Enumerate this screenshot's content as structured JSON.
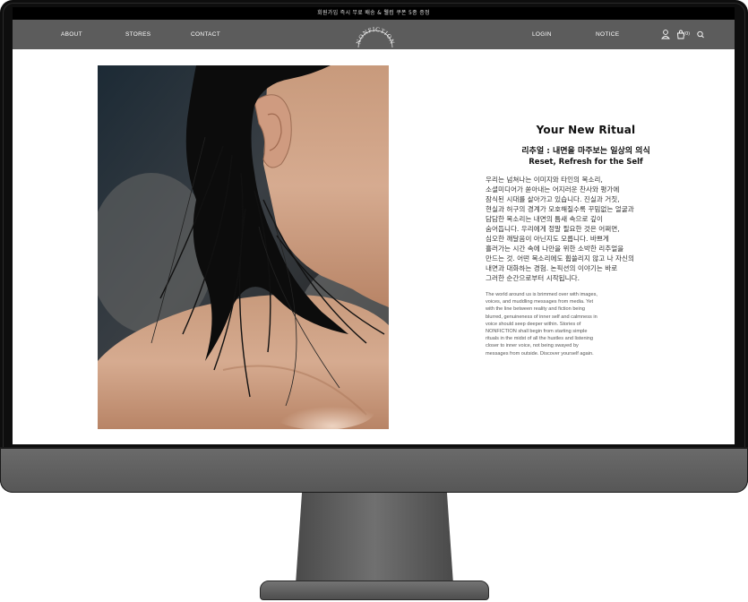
{
  "announcement": "회원가입 즉시 무료 배송 & 웰컴 쿠폰 5종 증정",
  "nav": {
    "left": [
      "ABOUT",
      "STORES",
      "CONTACT"
    ],
    "logo": "NONFICTION",
    "right": [
      "LOGIN",
      "NOTICE"
    ],
    "cart_count": "(0)",
    "icons": [
      "user-icon",
      "cart-icon",
      "search-icon"
    ]
  },
  "content": {
    "title": "Your New Ritual",
    "subtitle_ko": "리추얼 : 내면을 마주보는 일상의 의식",
    "subtitle_en": "Reset, Refresh for the Self",
    "body_ko": [
      "우리는 넘쳐나는 이미지와 타인의 목소리,",
      "소셜미디어가 쏟아내는 어지러운 찬사와 평가에",
      "잠식된 시대를 살아가고 있습니다. 진실과 거짓,",
      "현실과 허구의 경계가 모호해질수록 꾸밈없는 얼굴과",
      "담담한 목소리는 내면의 틈새 속으로 깊이",
      "숨어듭니다. 우리에게 정말 필요한 것은 어쩌면,",
      "심오한 깨달음이 아닌지도 모릅니다. 바쁘게",
      "흘러가는 시간 속에 나만을 위한 소박한 리추얼을",
      "만드는 것. 어떤 목소리에도 휩쓸리지 않고 나 자신의",
      "내면과 대화하는 경험. 논픽션의 이야기는 바로",
      "그러한 순간으로부터 시작됩니다."
    ],
    "body_en": [
      "The world around us is brimmed over with images,",
      "voices, and muddling messages from media. Yet",
      "with the line between reality and fiction being",
      "blurred, genuineness of inner self and calmness in",
      "voice should seep deeper within. Stories of",
      "NONFICTION shall begin from starting simple",
      "rituals in the midst of all the hustles and listening",
      "closer to inner voice, not being swayed by",
      "messages from outside. Discover yourself again."
    ]
  },
  "colors": {
    "navbar": "#5c5c5c",
    "announcement_bg": "#000000",
    "monitor_bezel": "#0e0e0e",
    "monitor_chin": "#5f5f5f"
  }
}
